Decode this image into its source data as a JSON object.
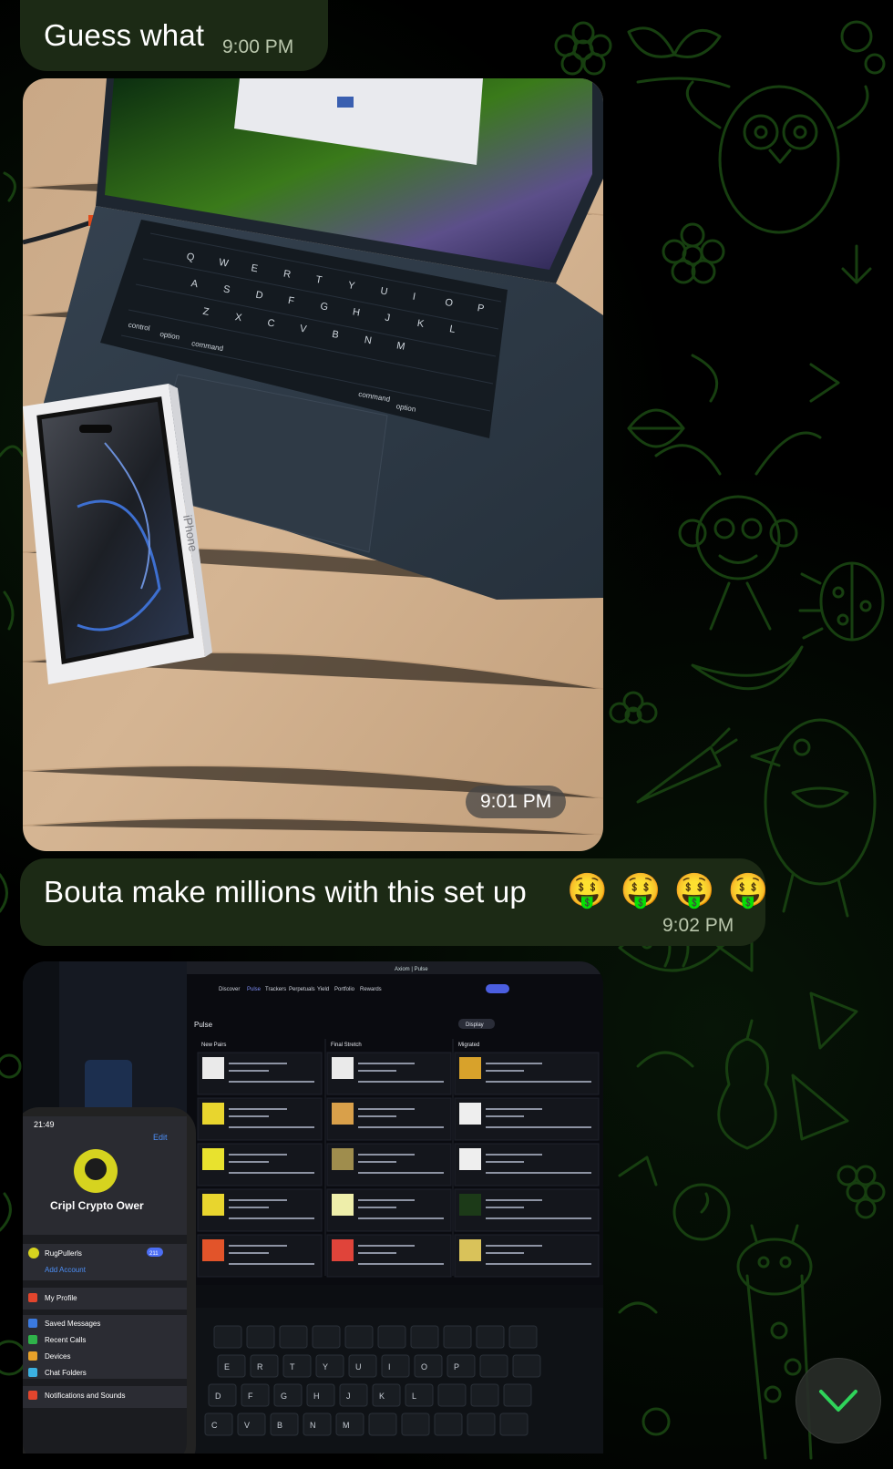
{
  "messages": [
    {
      "text": "Guess what",
      "time": "9:00 PM"
    },
    {
      "type": "photo",
      "time": "9:01 PM"
    },
    {
      "text": "Bouta make millions with this set up",
      "emoji": "🤑 🤑 🤑 🤑",
      "time": "9:02 PM"
    },
    {
      "type": "photo"
    }
  ],
  "keyboard": {
    "row1": [
      "Q",
      "W",
      "E",
      "R",
      "T",
      "Y",
      "U",
      "I",
      "O",
      "P"
    ],
    "row2": [
      "A",
      "S",
      "D",
      "F",
      "G",
      "H",
      "J",
      "K",
      "L"
    ],
    "row3": [
      "Z",
      "X",
      "C",
      "V",
      "B",
      "N",
      "M"
    ],
    "mods": [
      "control",
      "option",
      "command",
      "command",
      "option"
    ]
  },
  "phone_screen": {
    "time": "21:49",
    "edit": "Edit",
    "name": "Cripl Crypto Ower",
    "account": "RugPullerls",
    "add_account": "Add Account",
    "menu": [
      "My Profile",
      "Saved Messages",
      "Recent Calls",
      "Devices",
      "Chat Folders",
      "Notifications and Sounds"
    ],
    "badge": "211"
  },
  "monitor_screen": {
    "title": "Axiom | Pulse",
    "nav": [
      "Discover",
      "Pulse",
      "Trackers",
      "Perpetuals",
      "Yield",
      "Portfolio",
      "Rewards"
    ],
    "section": "Pulse",
    "columns": [
      "New Pairs",
      "Final Stretch",
      "Migrated"
    ],
    "display_btn": "Display"
  },
  "colors": {
    "bubble": "#1c2a15",
    "time_text": "#b9c6ac",
    "pattern": "#1a4a12"
  }
}
